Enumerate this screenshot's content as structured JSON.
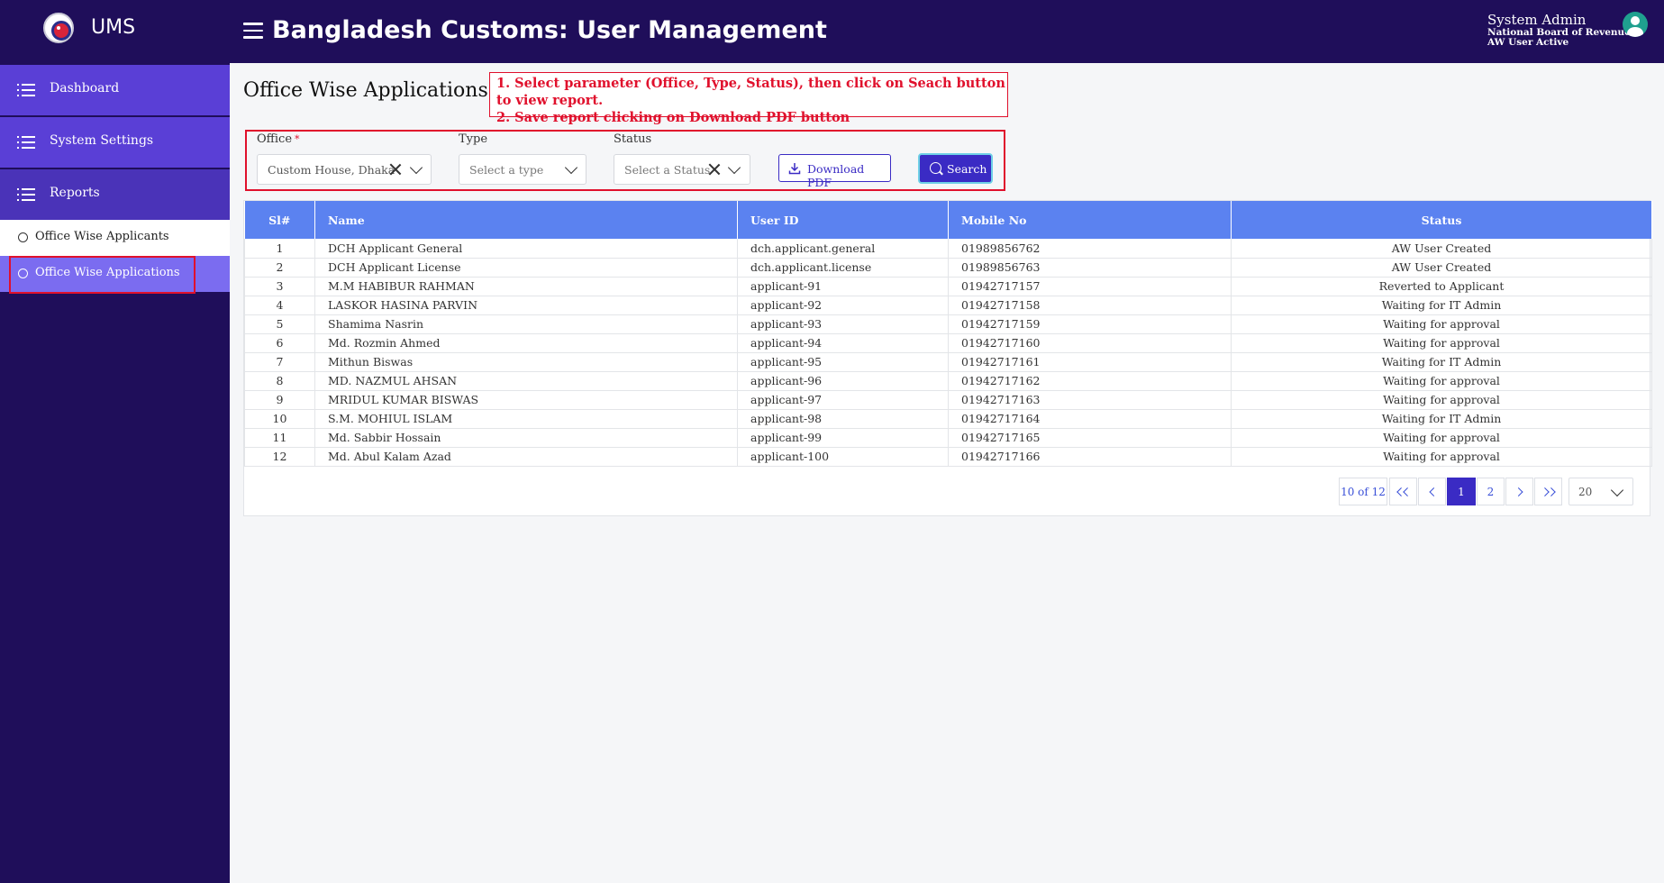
{
  "header": {
    "brand": "UMS",
    "title": "Bangladesh Customs: User Management",
    "user": {
      "name": "System Admin",
      "organization": "National Board of Revenue",
      "status": "AW User Active"
    }
  },
  "sidebar": {
    "items": [
      {
        "label": "Dashboard"
      },
      {
        "label": "System Settings"
      },
      {
        "label": "Reports"
      }
    ],
    "subitems": [
      {
        "label": "Office Wise Applicants"
      },
      {
        "label": "Office Wise Applications"
      }
    ]
  },
  "page": {
    "title": "Office Wise Applications",
    "instructions": [
      "1. Select parameter (Office, Type, Status), then click on Seach button to view report.",
      "2. Save report clicking on Download PDF button"
    ]
  },
  "filters": {
    "office": {
      "label": "Office",
      "required_mark": "*",
      "value": "Custom House, Dhaka"
    },
    "type": {
      "label": "Type",
      "placeholder": "Select a type"
    },
    "status": {
      "label": "Status",
      "placeholder": "Select a Status"
    },
    "download_label": "Download PDF",
    "search_label": "Search"
  },
  "table": {
    "columns": [
      "Sl#",
      "Name",
      "User ID",
      "Mobile No",
      "Status"
    ],
    "rows": [
      [
        "1",
        "DCH Applicant General",
        "dch.applicant.general",
        "01989856762",
        "AW User Created"
      ],
      [
        "2",
        "DCH Applicant License",
        "dch.applicant.license",
        "01989856763",
        "AW User Created"
      ],
      [
        "3",
        "M.M HABIBUR RAHMAN",
        "applicant-91",
        "01942717157",
        "Reverted to Applicant"
      ],
      [
        "4",
        "LASKOR HASINA PARVIN",
        "applicant-92",
        "01942717158",
        "Waiting for IT Admin"
      ],
      [
        "5",
        "Shamima Nasrin",
        "applicant-93",
        "01942717159",
        "Waiting for approval"
      ],
      [
        "6",
        "Md. Rozmin Ahmed",
        "applicant-94",
        "01942717160",
        "Waiting for approval"
      ],
      [
        "7",
        "Mithun Biswas",
        "applicant-95",
        "01942717161",
        "Waiting for IT Admin"
      ],
      [
        "8",
        "MD. NAZMUL AHSAN",
        "applicant-96",
        "01942717162",
        "Waiting for approval"
      ],
      [
        "9",
        "MRIDUL KUMAR BISWAS",
        "applicant-97",
        "01942717163",
        "Waiting for approval"
      ],
      [
        "10",
        "S.M. MOHIUL ISLAM",
        "applicant-98",
        "01942717164",
        "Waiting for IT Admin"
      ],
      [
        "11",
        "Md. Sabbir Hossain",
        "applicant-99",
        "01942717165",
        "Waiting for approval"
      ],
      [
        "12",
        "Md. Abul Kalam Azad",
        "applicant-100",
        "01942717166",
        "Waiting for approval"
      ]
    ]
  },
  "pagination": {
    "info": "10 of 12",
    "pages": [
      "1",
      "2"
    ],
    "current_page": "1",
    "page_size": "20"
  },
  "colors": {
    "primary_dark": "#1f0e5a",
    "accent": "#3a2bc4",
    "table_header": "#5b82f0",
    "annotation_red": "#e0102c"
  }
}
